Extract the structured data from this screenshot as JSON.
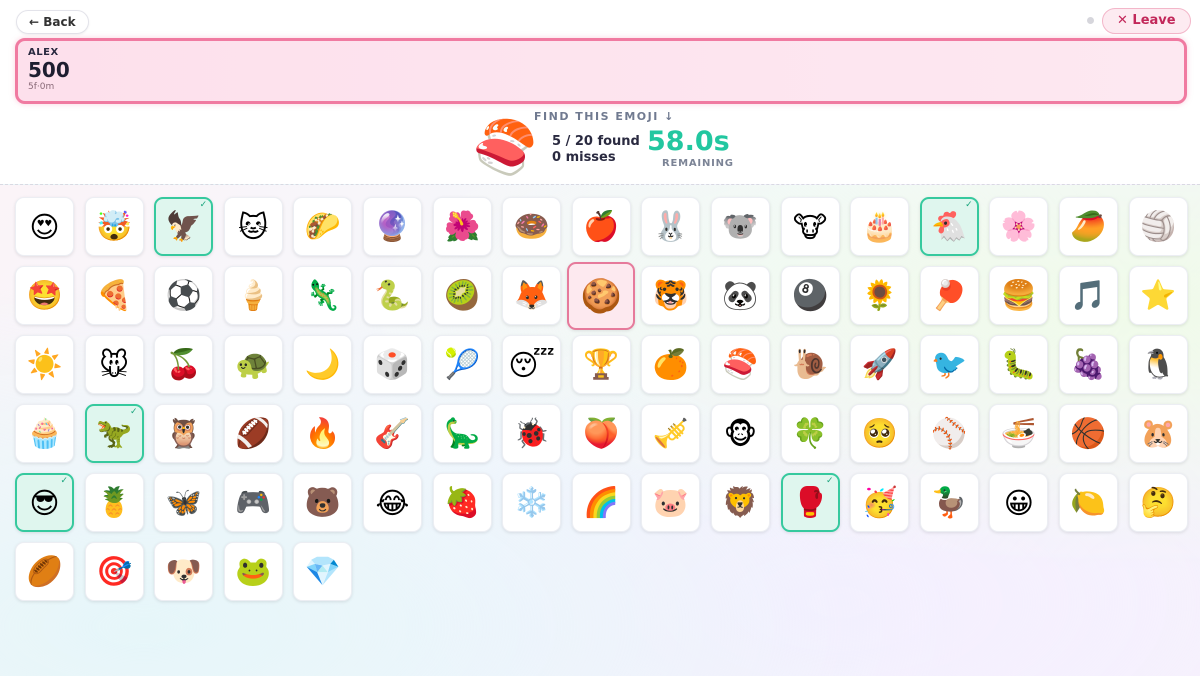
{
  "topbar": {
    "back_label": "← Back",
    "leave_label": "✕ Leave"
  },
  "player": {
    "name": "ALEX",
    "score": "500",
    "meta": "5f·0m"
  },
  "prompt": {
    "label": "FIND THIS EMOJI ↓",
    "target_emoji": "🍣",
    "found_text": "5 / 20 found",
    "misses_text": "0 misses",
    "timer": "58.0s",
    "timer_label": "REMAINING"
  },
  "colors": {
    "accent": "#22c7a0",
    "found_border": "#36c99e",
    "player_border": "#f07aa1",
    "selected_border": "#e67a9b"
  },
  "check_mark": "✓",
  "tiles": [
    {
      "emoji": "😍",
      "state": "normal"
    },
    {
      "emoji": "🤯",
      "state": "normal"
    },
    {
      "emoji": "🦅",
      "state": "found"
    },
    {
      "emoji": "🐱",
      "state": "normal"
    },
    {
      "emoji": "🌮",
      "state": "normal"
    },
    {
      "emoji": "🔮",
      "state": "normal"
    },
    {
      "emoji": "🌺",
      "state": "normal"
    },
    {
      "emoji": "🍩",
      "state": "normal"
    },
    {
      "emoji": "🍎",
      "state": "normal"
    },
    {
      "emoji": "🐰",
      "state": "normal"
    },
    {
      "emoji": "🐨",
      "state": "normal"
    },
    {
      "emoji": "🐮",
      "state": "normal"
    },
    {
      "emoji": "🎂",
      "state": "normal"
    },
    {
      "emoji": "🐔",
      "state": "found"
    },
    {
      "emoji": "🌸",
      "state": "normal"
    },
    {
      "emoji": "🥭",
      "state": "normal"
    },
    {
      "emoji": "🏐",
      "state": "normal"
    },
    {
      "emoji": "🤩",
      "state": "normal"
    },
    {
      "emoji": "🍕",
      "state": "normal"
    },
    {
      "emoji": "⚽",
      "state": "normal"
    },
    {
      "emoji": "🍦",
      "state": "normal"
    },
    {
      "emoji": "🦎",
      "state": "normal"
    },
    {
      "emoji": "🐍",
      "state": "normal"
    },
    {
      "emoji": "🥝",
      "state": "normal"
    },
    {
      "emoji": "🦊",
      "state": "normal"
    },
    {
      "emoji": "🍪",
      "state": "selected"
    },
    {
      "emoji": "🐯",
      "state": "normal"
    },
    {
      "emoji": "🐼",
      "state": "normal"
    },
    {
      "emoji": "🎱",
      "state": "normal"
    },
    {
      "emoji": "🌻",
      "state": "normal"
    },
    {
      "emoji": "🏓",
      "state": "normal"
    },
    {
      "emoji": "🍔",
      "state": "normal"
    },
    {
      "emoji": "🎵",
      "state": "normal"
    },
    {
      "emoji": "⭐",
      "state": "normal"
    },
    {
      "emoji": "☀️",
      "state": "normal"
    },
    {
      "emoji": "🐭",
      "state": "normal"
    },
    {
      "emoji": "🍒",
      "state": "normal"
    },
    {
      "emoji": "🐢",
      "state": "normal"
    },
    {
      "emoji": "🌙",
      "state": "normal"
    },
    {
      "emoji": "🎲",
      "state": "normal"
    },
    {
      "emoji": "🎾",
      "state": "normal"
    },
    {
      "emoji": "😴",
      "state": "normal"
    },
    {
      "emoji": "🏆",
      "state": "normal"
    },
    {
      "emoji": "🍊",
      "state": "normal"
    },
    {
      "emoji": "🍣",
      "state": "normal"
    },
    {
      "emoji": "🐌",
      "state": "normal"
    },
    {
      "emoji": "🚀",
      "state": "normal"
    },
    {
      "emoji": "🐦",
      "state": "normal"
    },
    {
      "emoji": "🐛",
      "state": "normal"
    },
    {
      "emoji": "🍇",
      "state": "normal"
    },
    {
      "emoji": "🐧",
      "state": "normal"
    },
    {
      "emoji": "🧁",
      "state": "normal"
    },
    {
      "emoji": "🦖",
      "state": "found"
    },
    {
      "emoji": "🦉",
      "state": "normal"
    },
    {
      "emoji": "🏈",
      "state": "normal"
    },
    {
      "emoji": "🔥",
      "state": "normal"
    },
    {
      "emoji": "🎸",
      "state": "normal"
    },
    {
      "emoji": "🦕",
      "state": "normal"
    },
    {
      "emoji": "🐞",
      "state": "normal"
    },
    {
      "emoji": "🍑",
      "state": "normal"
    },
    {
      "emoji": "🎺",
      "state": "normal"
    },
    {
      "emoji": "🐵",
      "state": "normal"
    },
    {
      "emoji": "🍀",
      "state": "normal"
    },
    {
      "emoji": "🥺",
      "state": "normal"
    },
    {
      "emoji": "⚾",
      "state": "normal"
    },
    {
      "emoji": "🍜",
      "state": "normal"
    },
    {
      "emoji": "🏀",
      "state": "normal"
    },
    {
      "emoji": "🐹",
      "state": "normal"
    },
    {
      "emoji": "😎",
      "state": "found"
    },
    {
      "emoji": "🍍",
      "state": "normal"
    },
    {
      "emoji": "🦋",
      "state": "normal"
    },
    {
      "emoji": "🎮",
      "state": "normal"
    },
    {
      "emoji": "🐻",
      "state": "normal"
    },
    {
      "emoji": "😂",
      "state": "normal"
    },
    {
      "emoji": "🍓",
      "state": "normal"
    },
    {
      "emoji": "❄️",
      "state": "normal"
    },
    {
      "emoji": "🌈",
      "state": "normal"
    },
    {
      "emoji": "🐷",
      "state": "normal"
    },
    {
      "emoji": "🦁",
      "state": "normal"
    },
    {
      "emoji": "🥊",
      "state": "found"
    },
    {
      "emoji": "🥳",
      "state": "normal"
    },
    {
      "emoji": "🦆",
      "state": "normal"
    },
    {
      "emoji": "😀",
      "state": "normal"
    },
    {
      "emoji": "🍋",
      "state": "normal"
    },
    {
      "emoji": "🤔",
      "state": "normal"
    },
    {
      "emoji": "🏉",
      "state": "normal"
    },
    {
      "emoji": "🎯",
      "state": "normal"
    },
    {
      "emoji": "🐶",
      "state": "normal"
    },
    {
      "emoji": "🐸",
      "state": "normal"
    },
    {
      "emoji": "💎",
      "state": "normal"
    }
  ]
}
